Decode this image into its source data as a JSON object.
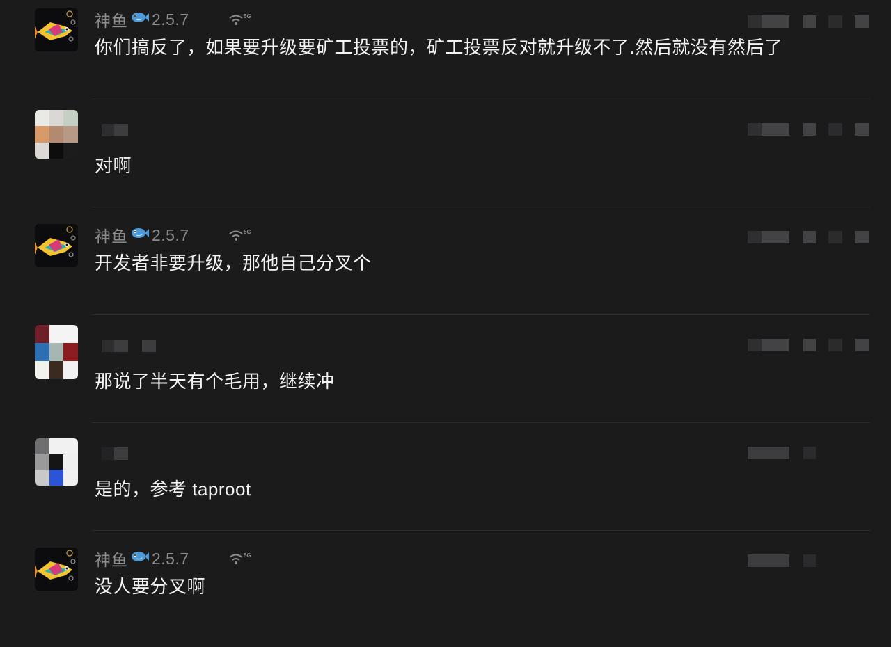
{
  "comments": [
    {
      "author": "神鱼",
      "badge": "2.5.7",
      "text": "你们搞反了，如果要升级要矿工投票的，矿工投票反对就升级不了.然后就没有然后了"
    },
    {
      "author": "",
      "badge": "",
      "text": "对啊"
    },
    {
      "author": "神鱼",
      "badge": "2.5.7",
      "text": "开发者非要升级，那他自己分叉个"
    },
    {
      "author": "",
      "badge": "",
      "text": "那说了半天有个毛用，继续冲"
    },
    {
      "author": "",
      "badge": "",
      "text": "是的，参考 taproot"
    },
    {
      "author": "神鱼",
      "badge": "2.5.7",
      "text": "没人要分叉啊"
    }
  ],
  "icons": {
    "fish_badge": "fish-icon",
    "signal": "wifi-5g-icon"
  },
  "signal_label": "5G",
  "colors": {
    "background": "#1b1b1c",
    "text": "#f3f3f3",
    "muted": "#8c8c8e"
  }
}
